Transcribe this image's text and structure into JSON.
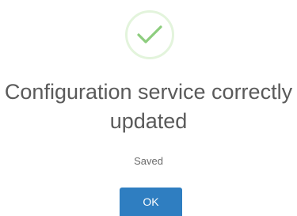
{
  "dialog": {
    "icon": "check-icon",
    "icon_color": "#8dcd7e",
    "icon_ring_color": "#e3f4dc",
    "title": "Configuration service correctly updated",
    "message": "Saved",
    "ok_label": "OK",
    "button_color": "#2f7ec1"
  }
}
